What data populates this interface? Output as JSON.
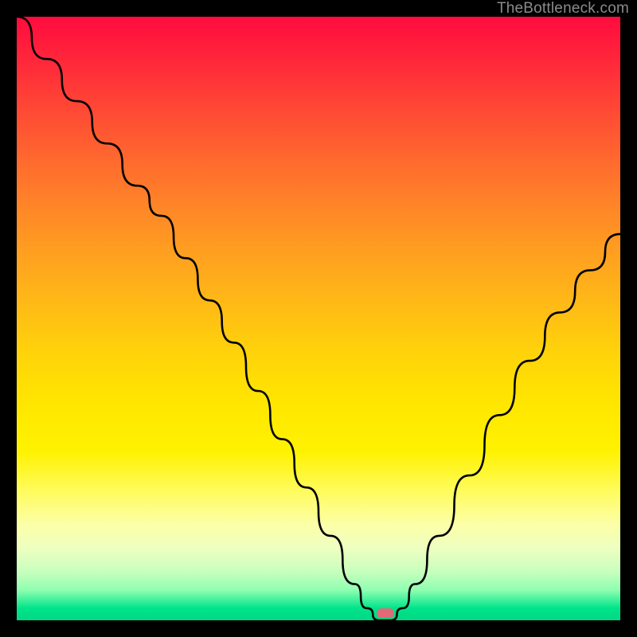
{
  "watermark": "TheBottleneck.com",
  "marker": {
    "x_percent": 61,
    "color": "#e16a79"
  },
  "chart_data": {
    "type": "line",
    "title": "",
    "xlabel": "",
    "ylabel": "",
    "xlim": [
      0,
      100
    ],
    "ylim": [
      0,
      100
    ],
    "gradient_note": "background encodes severity: red=top (high bottleneck), green=bottom (low bottleneck)",
    "series": [
      {
        "name": "bottleneck-curve",
        "x": [
          0,
          5,
          10,
          15,
          20,
          24,
          28,
          32,
          36,
          40,
          44,
          48,
          52,
          56,
          58,
          60,
          62,
          64,
          66,
          70,
          75,
          80,
          85,
          90,
          95,
          100
        ],
        "values": [
          100,
          93,
          86,
          79,
          72,
          67,
          60,
          53,
          46,
          38,
          30,
          22,
          14,
          6,
          2,
          0,
          0,
          2,
          6,
          14,
          24,
          34,
          43,
          51,
          58,
          64
        ]
      }
    ],
    "marker_point": {
      "x": 61,
      "y": 0
    }
  }
}
